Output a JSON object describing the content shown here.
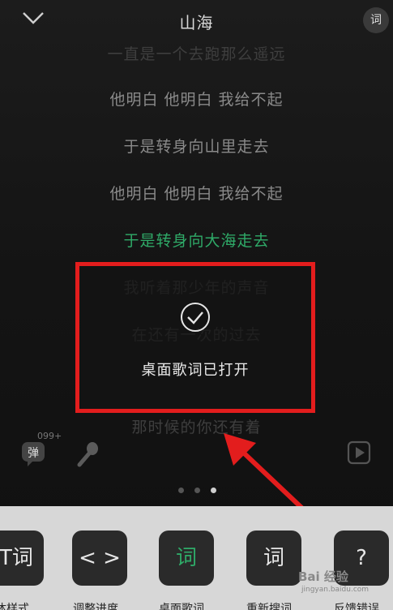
{
  "header": {
    "title": "山海",
    "lyric_icon_label": "词"
  },
  "lyrics": [
    {
      "text": "一直是一个去跑那么遥远",
      "state": "faded"
    },
    {
      "text": "他明白 他明白 我给不起",
      "state": "normal"
    },
    {
      "text": "于是转身向山里走去",
      "state": "normal"
    },
    {
      "text": "他明白 他明白 我给不起",
      "state": "normal"
    },
    {
      "text": "于是转身向大海走去",
      "state": "active"
    },
    {
      "text": "我听着那少年的声音",
      "state": "dim"
    },
    {
      "text": "在还有一次的过去",
      "state": "dim"
    },
    {
      "text": "那时候的你还有着",
      "state": "faded"
    }
  ],
  "toast": {
    "message": "桌面歌词已打开"
  },
  "controls": {
    "danmu_label": "弹",
    "danmu_count": "099+"
  },
  "pager": {
    "count": 3,
    "active_index": 2
  },
  "tiles": [
    {
      "label": "字体样式",
      "icon": "T词",
      "icon_name": "font-style-icon"
    },
    {
      "label": "调整进度",
      "icon": "< >",
      "icon_name": "adjust-progress-icon"
    },
    {
      "label": "桌面歌词",
      "icon": "词",
      "icon_name": "desktop-lyrics-icon"
    },
    {
      "label": "重新搜词",
      "icon": "词",
      "icon_name": "research-lyrics-icon"
    },
    {
      "label": "反馈错误",
      "icon": "?",
      "icon_name": "feedback-icon"
    }
  ],
  "watermark": {
    "main": "Bai 经验",
    "sub": "jingyan.baidu.com"
  },
  "colors": {
    "active_lyric": "#2faa68",
    "highlight": "#e31d1d"
  }
}
